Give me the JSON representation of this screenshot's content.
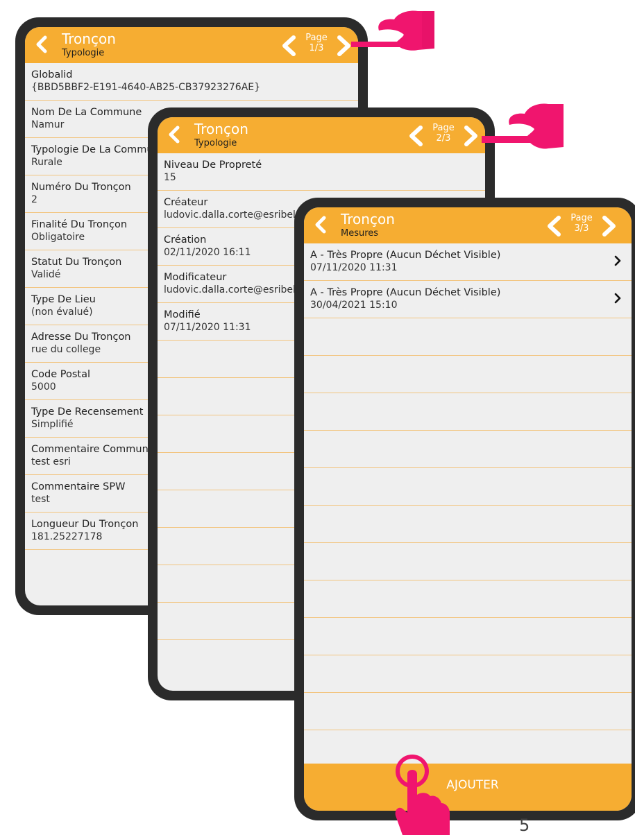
{
  "screens": [
    {
      "title": "Tronçon",
      "subtitle": "Typologie",
      "pager": {
        "label_line1": "Page",
        "label_line2": "1/3"
      },
      "fields": [
        {
          "label": "Globalid",
          "value": "{BBD5BBF2-E191-4640-AB25-CB37923276AE}"
        },
        {
          "label": "Nom De La Commune",
          "value": "Namur"
        },
        {
          "label": "Typologie De La Commune",
          "value": "Rurale"
        },
        {
          "label": "Numéro Du Tronçon",
          "value": "2"
        },
        {
          "label": "Finalité Du Tronçon",
          "value": "Obligatoire"
        },
        {
          "label": "Statut Du Tronçon",
          "value": "Validé"
        },
        {
          "label": "Type De Lieu",
          "value": "(non évalué)"
        },
        {
          "label": "Adresse Du Tronçon",
          "value": "rue du college"
        },
        {
          "label": "Code Postal",
          "value": "5000"
        },
        {
          "label": "Type De Recensement",
          "value": "Simplifié"
        },
        {
          "label": "Commentaire Communal",
          "value": "test esri"
        },
        {
          "label": "Commentaire SPW",
          "value": "test"
        },
        {
          "label": "Longueur Du Tronçon",
          "value": "181.25227178"
        }
      ]
    },
    {
      "title": "Tronçon",
      "subtitle": "Typologie",
      "pager": {
        "label_line1": "Page",
        "label_line2": "2/3"
      },
      "fields": [
        {
          "label": "Niveau De Propreté",
          "value": "15"
        },
        {
          "label": "Créateur",
          "value": "ludovic.dalla.corte@esribelux.com"
        },
        {
          "label": "Création",
          "value": "02/11/2020 16:11"
        },
        {
          "label": "Modificateur",
          "value": "ludovic.dalla.corte@esribelux.com"
        },
        {
          "label": "Modifié",
          "value": "07/11/2020 11:31"
        }
      ]
    },
    {
      "title": "Tronçon",
      "subtitle": "Mesures",
      "pager": {
        "label_line1": "Page",
        "label_line2": "3/3"
      },
      "items": [
        {
          "label": "A - Très Propre (Aucun Déchet Visible)",
          "date": "07/11/2020 11:31"
        },
        {
          "label": "A - Très Propre (Aucun Déchet Visible)",
          "date": "30/04/2021 15:10"
        }
      ],
      "add_button": "AJOUTER"
    }
  ],
  "slide_number": "5",
  "colors": {
    "accent": "#f6ad32",
    "frame": "#2b2b2b",
    "screen_bg": "#efefef",
    "divider": "#f2c47e",
    "hand": "#f0156e"
  },
  "icons": [
    "chevron-left-icon",
    "chevron-right-icon",
    "pointing-hand-icon",
    "tap-hand-icon"
  ]
}
